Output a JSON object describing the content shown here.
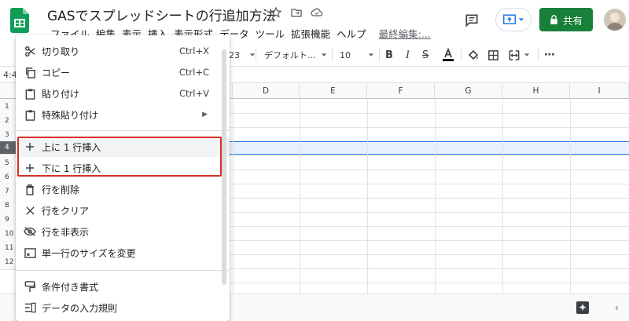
{
  "app": {
    "title": "GASでスプレッドシートの行追加方法",
    "menu": [
      "ファイル",
      "編集",
      "表示",
      "挿入",
      "表示形式",
      "データ",
      "ツール",
      "拡張機能",
      "ヘルプ"
    ],
    "last_edit": "最終編集:...",
    "share_label": "共有"
  },
  "toolbar": {
    "format_num": "123",
    "font": "デフォルト...",
    "font_size": "10"
  },
  "cell_ref": "4:4",
  "grid": {
    "columns": [
      "D",
      "E",
      "F",
      "G",
      "H",
      "I"
    ],
    "rows": [
      "1",
      "2",
      "3",
      "4",
      "5",
      "6",
      "7",
      "8",
      "9",
      "10",
      "11",
      "12"
    ],
    "selected_row": "4"
  },
  "context_menu": {
    "items": [
      {
        "icon": "scissors-icon",
        "label": "切り取り",
        "shortcut": "Ctrl+X"
      },
      {
        "icon": "copy-icon",
        "label": "コピー",
        "shortcut": "Ctrl+C"
      },
      {
        "icon": "paste-icon",
        "label": "貼り付け",
        "shortcut": "Ctrl+V"
      },
      {
        "icon": "paste-special-icon",
        "label": "特殊貼り付け",
        "shortcut": ""
      },
      {
        "icon": "plus-icon",
        "label": "上に 1 行挿入",
        "shortcut": ""
      },
      {
        "icon": "plus-icon",
        "label": "下に 1 行挿入",
        "shortcut": ""
      },
      {
        "icon": "trash-icon",
        "label": "行を削除",
        "shortcut": ""
      },
      {
        "icon": "close-icon",
        "label": "行をクリア",
        "shortcut": ""
      },
      {
        "icon": "eye-off-icon",
        "label": "行を非表示",
        "shortcut": ""
      },
      {
        "icon": "resize-icon",
        "label": "単一行のサイズを変更",
        "shortcut": ""
      },
      {
        "icon": "format-paint-icon",
        "label": "条件付き書式",
        "shortcut": ""
      },
      {
        "icon": "data-validation-icon",
        "label": "データの入力規則",
        "shortcut": ""
      }
    ]
  },
  "colors": {
    "accent": "#1a73e8",
    "share_green": "#188038",
    "highlight_red": "#d93025"
  }
}
